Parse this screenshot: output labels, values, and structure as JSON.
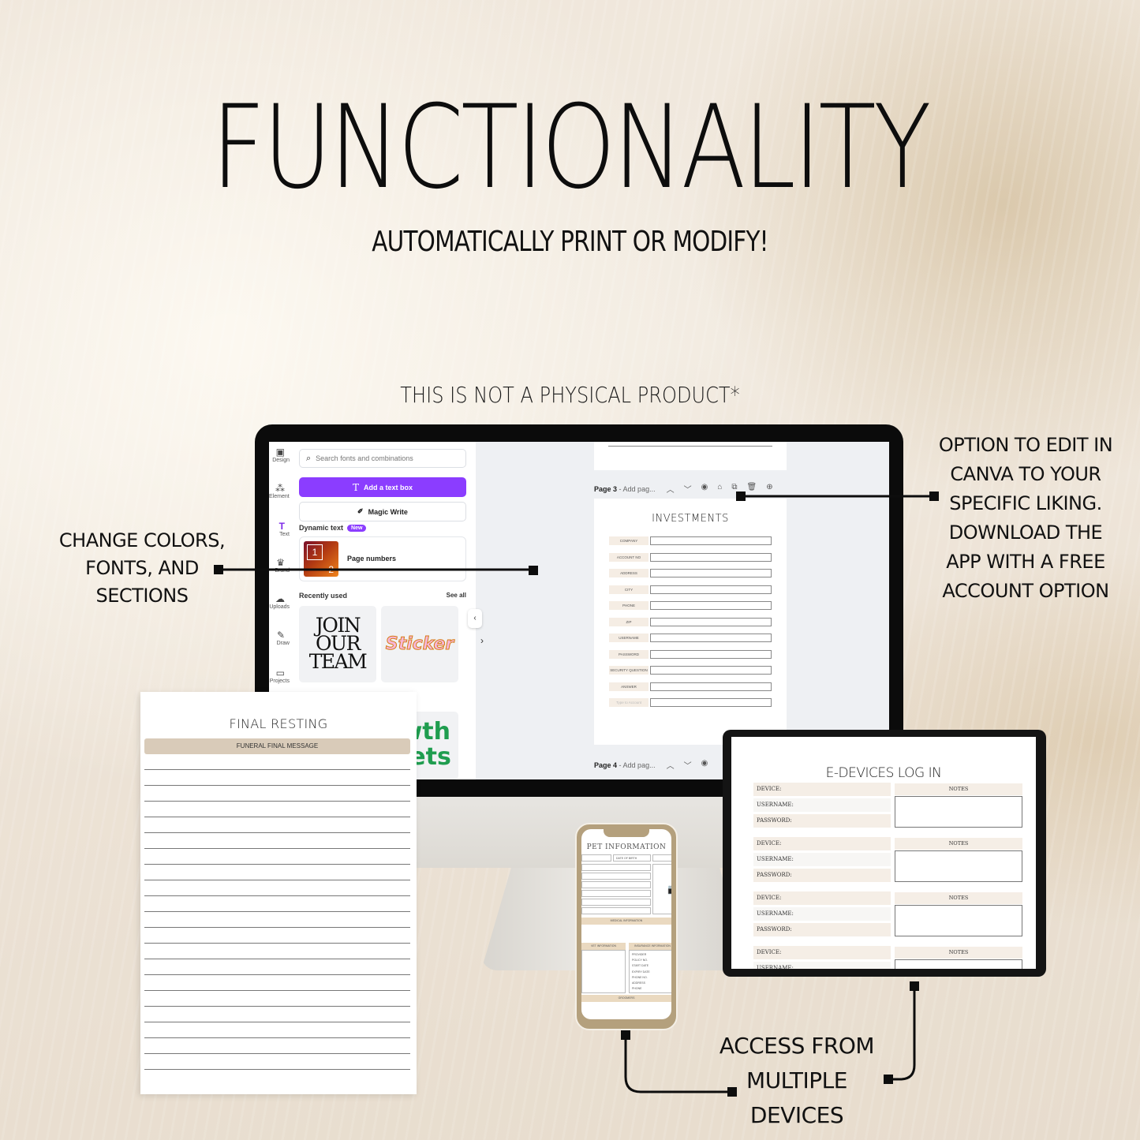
{
  "hero": {
    "title": "FUNCTIONALITY",
    "subtitle": "AUTOMATICALLY PRINT OR MODIFY!",
    "disclaimer": "THIS IS NOT A PHYSICAL PRODUCT*"
  },
  "callouts": {
    "left": [
      "CHANGE COLORS,",
      "FONTS, AND",
      "SECTIONS"
    ],
    "right": [
      "OPTION TO EDIT IN",
      "CANVA TO YOUR",
      "SPECIFIC LIKING.",
      "DOWNLOAD THE",
      "APP WITH A FREE",
      "ACCOUNT OPTION"
    ],
    "bottom": [
      "ACCESS FROM",
      "MULTIPLE",
      "DEVICES"
    ]
  },
  "canva": {
    "rail": [
      {
        "label": "Design",
        "icon": "layout-icon"
      },
      {
        "label": "Elements",
        "icon": "shapes-icon"
      },
      {
        "label": "Text",
        "icon": "text-icon",
        "active": true
      },
      {
        "label": "Brand",
        "icon": "brand-icon"
      },
      {
        "label": "Uploads",
        "icon": "upload-cloud-icon"
      },
      {
        "label": "Draw",
        "icon": "pen-icon"
      },
      {
        "label": "Projects",
        "icon": "folder-icon"
      }
    ],
    "search_placeholder": "Search fonts and combinations",
    "add_text_box": "Add a text box",
    "magic_write": "Magic Write",
    "dynamic_text": "Dynamic text",
    "new_badge": "New",
    "page_numbers": "Page numbers",
    "page_numbers_thumb": [
      "1",
      "2"
    ],
    "recently_used": "Recently used",
    "see_all": "See all",
    "tiles": {
      "join": [
        "JOIN",
        "OUR",
        "TEAM"
      ],
      "sticker": "Sticker",
      "growth": [
        "owth",
        "rgets"
      ]
    },
    "accent_color": "#8b3dff",
    "pages": [
      {
        "label": "Page 3",
        "title_placeholder": "- Add pag..."
      },
      {
        "label": "Page 4",
        "title_placeholder": "- Add pag..."
      }
    ],
    "document": {
      "title": "INVESTMENTS",
      "fields": [
        "COMPANY",
        "ACCOUNT NO",
        "ADDRESS",
        "CITY",
        "PHONE",
        "ZIP",
        "USERNAME",
        "PASSWORD",
        "SECURITY QUESTION",
        "ANSWER",
        "Type to Account"
      ]
    }
  },
  "paper": {
    "title": "FINAL RESTING",
    "banner": "FUNERAL FINAL MESSAGE"
  },
  "phone": {
    "title": "PET INFORMATION",
    "date_label": "DATE OF BIRTH",
    "medical": "MEDICAL INFORMATION",
    "vet": "VET INFORMATION",
    "insurance": "INSURANCE INFORMATION",
    "insurance_fields": [
      "PROVIDER",
      "POLICY NO.",
      "START DATE",
      "EXPIRY DATE",
      "PHONE NO.",
      "ADDRESS",
      "PHONE"
    ],
    "groomers": "GROOMERS"
  },
  "tablet": {
    "title": "E-DEVICES LOG IN",
    "device": "DEVICE:",
    "username": "USERNAME:",
    "password": "PASSWORD:",
    "notes": "NOTES"
  }
}
